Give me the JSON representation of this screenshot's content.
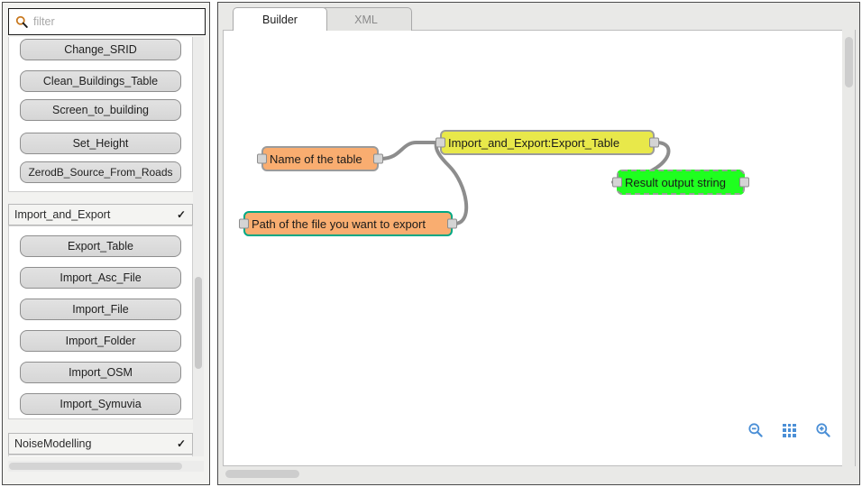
{
  "sidebar": {
    "search": {
      "icon": "search-icon",
      "placeholder": "filter",
      "value": ""
    },
    "groups": [
      {
        "label": "",
        "expanded": true,
        "items": [
          {
            "label": "Change_SRID"
          },
          {
            "label": "Clean_Buildings_Table"
          },
          {
            "label": "Screen_to_building"
          },
          {
            "label": "Set_Height"
          },
          {
            "label": "ZerodB_Source_From_Roads"
          }
        ]
      },
      {
        "label": "Import_and_Export",
        "expanded": true,
        "chevron": "chevron-down-icon",
        "items": [
          {
            "label": "Export_Table"
          },
          {
            "label": "Import_Asc_File"
          },
          {
            "label": "Import_File"
          },
          {
            "label": "Import_Folder"
          },
          {
            "label": "Import_OSM"
          },
          {
            "label": "Import_Symuvia"
          }
        ]
      },
      {
        "label": "NoiseModelling",
        "expanded": false,
        "chevron": "chevron-down-icon",
        "items": []
      }
    ]
  },
  "editor": {
    "tabs": [
      {
        "label": "Builder",
        "active": true
      },
      {
        "label": "XML",
        "active": false
      }
    ],
    "nodes": [
      {
        "id": "name-of-the-table",
        "label": "Name of the table",
        "kind": "orange",
        "selected": false
      },
      {
        "id": "path-of-the-file",
        "label": "Path of the file you want to export",
        "kind": "orange",
        "selected": true
      },
      {
        "id": "import-and-export-export-table",
        "label": "Import_and_Export:Export_Table",
        "kind": "yellow",
        "selected": false
      },
      {
        "id": "result-output-string",
        "label": "Result output string",
        "kind": "green",
        "selected": false
      }
    ],
    "zoom_controls": [
      {
        "name": "zoom-out-icon",
        "label": "Zoom out"
      },
      {
        "name": "zoom-fit-grid-icon",
        "label": "Zoom to fit"
      },
      {
        "name": "zoom-in-icon",
        "label": "Zoom in"
      }
    ]
  },
  "colors": {
    "node_orange": "#f9ad70",
    "node_yellow": "#e8e84a",
    "node_green": "#1fff1f",
    "selection_teal": "#00a884",
    "wire_gray": "#8d8d8d",
    "icon_blue": "#4b8fd6"
  }
}
